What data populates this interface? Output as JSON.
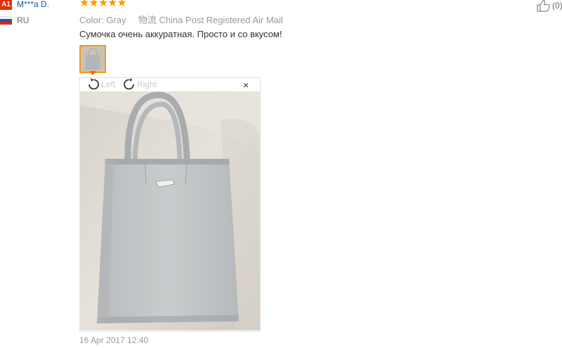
{
  "reviewer": {
    "badge": "A1",
    "name": "M***a D.",
    "country": "RU",
    "flag_colors": [
      "#ffffff",
      "#1c57a5",
      "#d52b1e"
    ]
  },
  "rating": {
    "stars": "★★★★★",
    "value": 5,
    "max": 5,
    "color": "#ff9a00"
  },
  "helpful": {
    "count": "(0)",
    "icon": "thumbs-up-icon"
  },
  "order_info": {
    "color_label": "Color:",
    "color_value": "Gray",
    "shipping_label": "物流",
    "shipping_value": "China Post Registered Air Mail"
  },
  "review": {
    "text": "Сумочка очень аккуратная. Просто и со вкусом!",
    "date": "16 Apr 2017 12:40"
  },
  "image_viewer": {
    "rotate_left_label": "Left",
    "rotate_right_label": "Right",
    "close_label": "×",
    "photo_subject": "gray tote bag"
  },
  "colors": {
    "accent": "#ff6a00",
    "link": "#0b5ea5",
    "badge": "#e62e04"
  }
}
